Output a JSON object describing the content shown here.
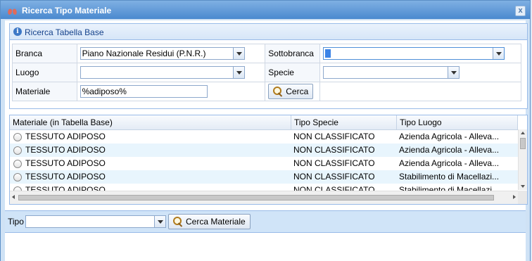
{
  "window": {
    "title": "Ricerca Tipo Materiale",
    "close_glyph": "x"
  },
  "section": {
    "title": "Ricerca Tabella Base",
    "info_glyph": "i"
  },
  "form": {
    "branca_label": "Branca",
    "branca_value": "Piano Nazionale Residui (P.N.R.)",
    "sottobranca_label": "Sottobranca",
    "sottobranca_value": "",
    "luogo_label": "Luogo",
    "luogo_value": "",
    "specie_label": "Specie",
    "specie_value": "",
    "materiale_label": "Materiale",
    "materiale_value": "%adiposo%",
    "cerca_label": "Cerca"
  },
  "grid": {
    "columns": [
      "Materiale (in Tabella Base)",
      "Tipo Specie",
      "Tipo Luogo"
    ],
    "rows": [
      [
        "TESSUTO ADIPOSO",
        "NON CLASSIFICATO",
        "Azienda Agricola - Alleva..."
      ],
      [
        "TESSUTO ADIPOSO",
        "NON CLASSIFICATO",
        "Azienda Agricola - Alleva..."
      ],
      [
        "TESSUTO ADIPOSO",
        "NON CLASSIFICATO",
        "Azienda Agricola - Alleva..."
      ],
      [
        "TESSUTO ADIPOSO",
        "NON CLASSIFICATO",
        "Stabilimento di Macellazi..."
      ],
      [
        "TESSUTO ADIPOSO",
        "NON CLASSIFICATO",
        "Stabilimento di Macellazi..."
      ]
    ]
  },
  "toolbar": {
    "tipo_label": "Tipo",
    "tipo_value": "",
    "cerca_materiale_label": "Cerca Materiale"
  },
  "colors": {
    "title_bar": "#4a89cf",
    "border": "#99bbe8",
    "row_alt": "#e8f5fd"
  }
}
